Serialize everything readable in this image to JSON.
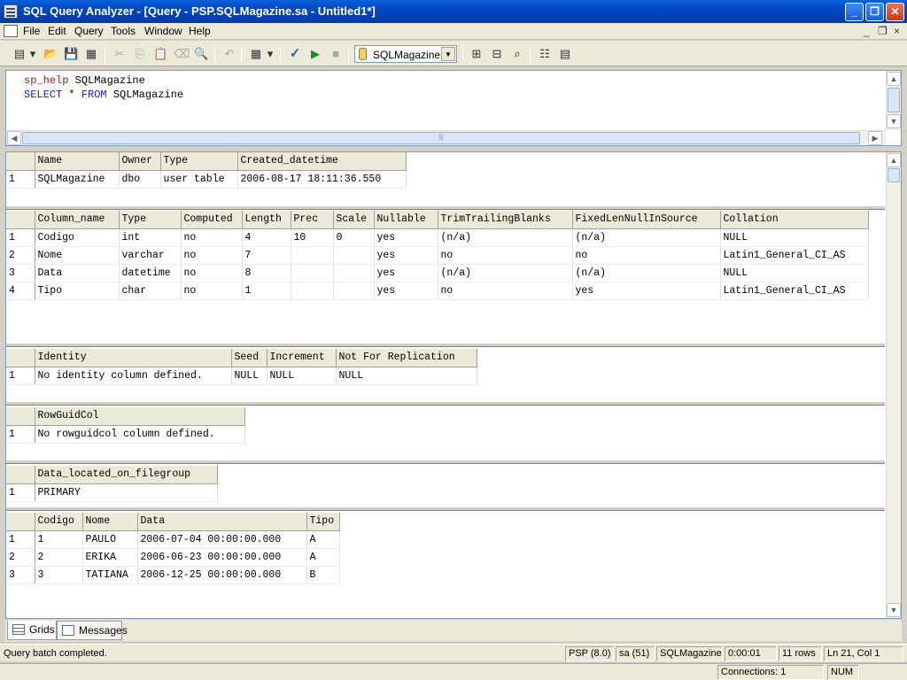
{
  "window": {
    "title": "SQL Query Analyzer - [Query - PSP.SQLMagazine.sa - Untitled1*]",
    "min_glyph": "_",
    "max_glyph": "❐",
    "close_glyph": "✕"
  },
  "menu": {
    "items": [
      "File",
      "Edit",
      "Query",
      "Tools",
      "Window",
      "Help"
    ],
    "mdi_min": "_",
    "mdi_restore": "❐",
    "mdi_close": "×"
  },
  "toolbar": {
    "database": "SQLMagazine",
    "combo_arrow": "▼",
    "tools": {
      "new_query": "▤",
      "dropdown": "▾",
      "open": "📂",
      "save": "💾",
      "print": "▦",
      "cut": "✂",
      "copy": "⎘",
      "paste": "📋",
      "clear": "⌫",
      "find": "🔍",
      "undo": "↶",
      "results_mode": "▦",
      "results_dropdown": "▾",
      "parse": "✓",
      "execute": "▶",
      "cancel": "■",
      "object_browser": "⊞",
      "estimated_plan": "⊟",
      "search": "⌕",
      "properties": "☷",
      "template": "▤"
    }
  },
  "editor": {
    "lines": [
      {
        "proc": "sp_help",
        "rest": " SQLMagazine"
      },
      {
        "kw1": "SELECT",
        "mid": " * ",
        "kw2": "FROM",
        "rest": " SQLMagazine"
      }
    ],
    "up_arrow": "▲",
    "down_arrow": "▼",
    "left_arrow": "◀",
    "right_arrow": "▶",
    "grip": "|||"
  },
  "results": {
    "grid1": {
      "headers": [
        "Name",
        "Owner",
        "Type",
        "Created_datetime"
      ],
      "rows": [
        [
          "1",
          "SQLMagazine",
          "dbo",
          "user table",
          "2006-08-17 18:11:36.550"
        ]
      ]
    },
    "grid2": {
      "headers": [
        "Column_name",
        "Type",
        "Computed",
        "Length",
        "Prec",
        "Scale",
        "Nullable",
        "TrimTrailingBlanks",
        "FixedLenNullInSource",
        "Collation"
      ],
      "rows": [
        [
          "1",
          "Codigo",
          "int",
          "no",
          "4",
          "10",
          "0",
          "yes",
          "(n/a)",
          "(n/a)",
          "NULL"
        ],
        [
          "2",
          "Nome",
          "varchar",
          "no",
          "7",
          "",
          "",
          "yes",
          "no",
          "no",
          "Latin1_General_CI_AS"
        ],
        [
          "3",
          "Data",
          "datetime",
          "no",
          "8",
          "",
          "",
          "yes",
          "(n/a)",
          "(n/a)",
          "NULL"
        ],
        [
          "4",
          "Tipo",
          "char",
          "no",
          "1",
          "",
          "",
          "yes",
          "no",
          "yes",
          "Latin1_General_CI_AS"
        ]
      ]
    },
    "grid3": {
      "headers": [
        "Identity",
        "Seed",
        "Increment",
        "Not For Replication"
      ],
      "rows": [
        [
          "1",
          "No identity column defined.",
          "NULL",
          "NULL",
          "NULL"
        ]
      ]
    },
    "grid4": {
      "headers": [
        "RowGuidCol"
      ],
      "rows": [
        [
          "1",
          "No rowguidcol column defined."
        ]
      ]
    },
    "grid5": {
      "headers": [
        "Data_located_on_filegroup"
      ],
      "rows": [
        [
          "1",
          "PRIMARY"
        ]
      ]
    },
    "grid6": {
      "headers": [
        "Codigo",
        "Nome",
        "Data",
        "Tipo"
      ],
      "rows": [
        [
          "1",
          "1",
          "PAULO",
          "2006-07-04 00:00:00.000",
          "A"
        ],
        [
          "2",
          "2",
          "ERIKA",
          "2006-06-23 00:00:00.000",
          "A"
        ],
        [
          "3",
          "3",
          "TATIANA",
          "2006-12-25 00:00:00.000",
          "B"
        ]
      ]
    }
  },
  "tabs": {
    "grids": "Grids",
    "messages": "Messages"
  },
  "status": {
    "message": "Query batch completed.",
    "server": "PSP (8.0)",
    "user": "sa (51)",
    "database": "SQLMagazine",
    "elapsed": "0:00:01",
    "rows": "11 rows",
    "position": "Ln 21, Col 1",
    "connections": "Connections: 1",
    "num": "NUM"
  }
}
